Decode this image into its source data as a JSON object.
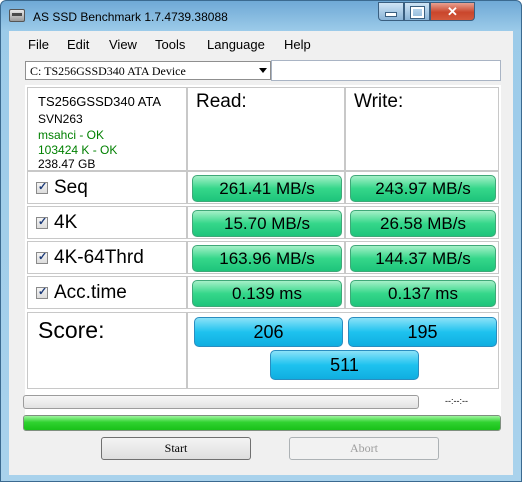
{
  "window": {
    "title": "AS SSD Benchmark 1.7.4739.38088"
  },
  "menu": [
    "File",
    "Edit",
    "View",
    "Tools",
    "Language",
    "Help"
  ],
  "drive_select": {
    "value": "C: TS256GSSD340 ATA Device"
  },
  "drive_info": {
    "model": "TS256GSSD340 ATA",
    "firmware": "SVN263",
    "driver": "msahci - OK",
    "alignment": "103424 K - OK",
    "capacity": "238.47 GB"
  },
  "headers": {
    "read": "Read:",
    "write": "Write:"
  },
  "rows": [
    {
      "label": "Seq",
      "checked": true,
      "read": "261.41 MB/s",
      "write": "243.97 MB/s"
    },
    {
      "label": "4K",
      "checked": true,
      "read": "15.70 MB/s",
      "write": "26.58 MB/s"
    },
    {
      "label": "4K-64Thrd",
      "checked": true,
      "read": "163.96 MB/s",
      "write": "144.37 MB/s"
    },
    {
      "label": "Acc.time",
      "checked": true,
      "read": "0.139 ms",
      "write": "0.137 ms"
    }
  ],
  "score": {
    "label": "Score:",
    "read": "206",
    "write": "195",
    "total": "511"
  },
  "progress": {
    "time": "--:--:--",
    "test_progress_pct": 0,
    "overall_progress_pct": 100
  },
  "buttons": {
    "start": "Start",
    "abort": "Abort"
  },
  "colors": {
    "result_green": "#35d78a",
    "score_cyan": "#1ec2ef",
    "progress_green": "#2fd22f"
  }
}
